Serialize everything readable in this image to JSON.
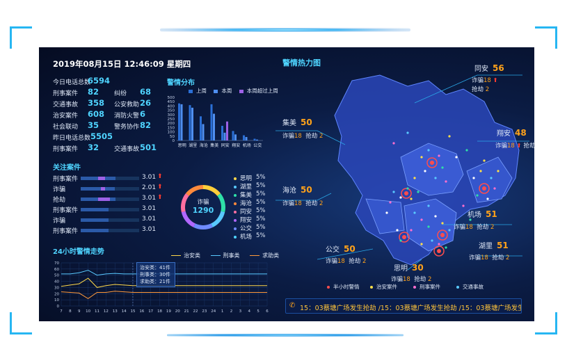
{
  "header": {
    "datetime": "2019年08月15日 12:46:09 星期四"
  },
  "stats": [
    {
      "label": "今日电话总数",
      "value": "6594"
    },
    {
      "label": "刑事案件",
      "value": "82"
    },
    {
      "label": "纠纷",
      "value": "68"
    },
    {
      "label": "交通事故",
      "value": "358"
    },
    {
      "label": "公安救助",
      "value": "26"
    },
    {
      "label": "治安案件",
      "value": "608"
    },
    {
      "label": "消防火警",
      "value": "6"
    },
    {
      "label": "社会联动",
      "value": "35"
    },
    {
      "label": "警务协作",
      "value": "82"
    },
    {
      "label": "昨日电话总数",
      "value": "5505"
    },
    {
      "label": "刑事案件",
      "value": "32"
    },
    {
      "label": "交通事故",
      "value": "501"
    }
  ],
  "sections": {
    "distribution": "警情分布",
    "focus_cases": "关注案件",
    "trend": "24小时警情走势",
    "heatmap": "警情热力图"
  },
  "chart_data": [
    {
      "type": "bar",
      "title": "警情分布",
      "categories": [
        "思明",
        "湖里",
        "海沧",
        "集美",
        "同安",
        "翔安",
        "机场",
        "公交"
      ],
      "series": [
        {
          "name": "上周",
          "values": [
            430,
            410,
            280,
            420,
            170,
            110,
            60,
            20
          ]
        },
        {
          "name": "本周",
          "values": [
            420,
            380,
            190,
            310,
            90,
            70,
            40,
            10
          ]
        },
        {
          "name": "本周超过上周",
          "values": [
            0,
            0,
            0,
            0,
            220,
            0,
            0,
            0
          ]
        }
      ],
      "ylim": [
        0,
        500
      ],
      "yticks": [
        0,
        50,
        100,
        150,
        200,
        250,
        300,
        350,
        400,
        450,
        500
      ],
      "colors": [
        "#2b6fd6",
        "#4f8ff0",
        "#9d61e6"
      ]
    },
    {
      "type": "line",
      "title": "24小时警情走势",
      "x": [
        "7",
        "8",
        "9",
        "10",
        "11",
        "12",
        "13",
        "14",
        "15",
        "16",
        "17",
        "18",
        "19",
        "20",
        "21",
        "22",
        "23",
        "24",
        "1",
        "2",
        "3",
        "4",
        "5",
        "6"
      ],
      "series": [
        {
          "name": "治安类",
          "values": [
            32,
            34,
            36,
            45,
            30,
            33,
            35,
            34,
            33,
            33,
            33,
            33,
            33,
            33,
            33,
            33,
            33,
            33,
            33,
            33,
            33,
            33,
            33,
            33
          ]
        },
        {
          "name": "刑事类",
          "values": [
            52,
            52,
            54,
            58,
            50,
            52,
            53,
            52,
            52,
            52,
            52,
            52,
            52,
            52,
            52,
            52,
            52,
            52,
            52,
            52,
            52,
            52,
            52,
            52
          ]
        },
        {
          "name": "求助类",
          "values": [
            23,
            22,
            21,
            12,
            22,
            22,
            24,
            23,
            22,
            22,
            22,
            22,
            22,
            22,
            22,
            22,
            22,
            22,
            22,
            22,
            22,
            22,
            22,
            22
          ]
        }
      ],
      "ylim": [
        0,
        70
      ],
      "yticks": [
        0,
        10,
        20,
        30,
        40,
        50,
        60,
        70
      ],
      "colors": [
        "#ffd84a",
        "#59c9ff",
        "#ff9a3c"
      ],
      "tooltip": [
        "治安类：41件",
        "刑事类：30件",
        "求助类：21件"
      ]
    }
  ],
  "focus_cases": [
    {
      "name": "刑事案件",
      "value": "3.01",
      "up": true
    },
    {
      "name": "诈骗",
      "value": "2.01",
      "up": true
    },
    {
      "name": "抢劫",
      "value": "3.01",
      "up": true
    },
    {
      "name": "刑事案件",
      "value": "3.01",
      "up": false
    },
    {
      "name": "诈骗",
      "value": "3.01",
      "up": false
    },
    {
      "name": "刑事案件",
      "value": "3.01",
      "up": false
    }
  ],
  "donut": {
    "label": "诈骗",
    "value": "1290",
    "colors": [
      "#ffcf3a",
      "#2fe0a8",
      "#59c9ff",
      "#6f8bff",
      "#b167ff",
      "#ff6fa0",
      "#ff8a3c"
    ]
  },
  "donut_legend": [
    {
      "name": "思明",
      "pct": "5%",
      "color": "#ffd84a"
    },
    {
      "name": "湖里",
      "pct": "5%",
      "color": "#59c9ff"
    },
    {
      "name": "集美",
      "pct": "5%",
      "color": "#2fe0a8"
    },
    {
      "name": "海沧",
      "pct": "5%",
      "color": "#ff8a3c"
    },
    {
      "name": "同安",
      "pct": "5%",
      "color": "#ff6fa0"
    },
    {
      "name": "翔安",
      "pct": "5%",
      "color": "#b167ff"
    },
    {
      "name": "公交",
      "pct": "5%",
      "color": "#6f8bff"
    },
    {
      "name": "机场",
      "pct": "5%",
      "color": "#4fd4ff"
    }
  ],
  "map": {
    "regions": [
      {
        "name": "同安",
        "count": "56",
        "fraud": "18",
        "robbery": "2",
        "key": "tongan"
      },
      {
        "name": "集美",
        "count": "50",
        "fraud": "18",
        "robbery": "2",
        "key": "jimei"
      },
      {
        "name": "翔安",
        "count": "48",
        "fraud": "18",
        "robbery": "2",
        "key": "xiangan"
      },
      {
        "name": "海沧",
        "count": "50",
        "fraud": "18",
        "robbery": "2",
        "key": "haicang"
      },
      {
        "name": "机场",
        "count": "51",
        "fraud": "18",
        "robbery": "2",
        "key": "jichang"
      },
      {
        "name": "湖里",
        "count": "51",
        "fraud": "18",
        "robbery": "2",
        "key": "huli"
      },
      {
        "name": "公交",
        "count": "50",
        "fraud": "18",
        "robbery": "2",
        "key": "gongjiao"
      },
      {
        "name": "思明",
        "count": "30",
        "fraud": "18",
        "robbery": "2",
        "key": "siming"
      }
    ],
    "fraud_label": "诈骗",
    "robbery_label": "抢劫",
    "legend": [
      {
        "name": "半小时警情",
        "color": "#ff4d4d"
      },
      {
        "name": "治安案件",
        "color": "#ffe04a"
      },
      {
        "name": "刑事案件",
        "color": "#ff6fd0"
      },
      {
        "name": "交通事故",
        "color": "#59c9ff"
      }
    ]
  },
  "ticker": {
    "text": "15：03蔡塘广场发生抢劫 /15：03蔡塘广场发生抢劫 /15：03蔡塘广场发生"
  }
}
